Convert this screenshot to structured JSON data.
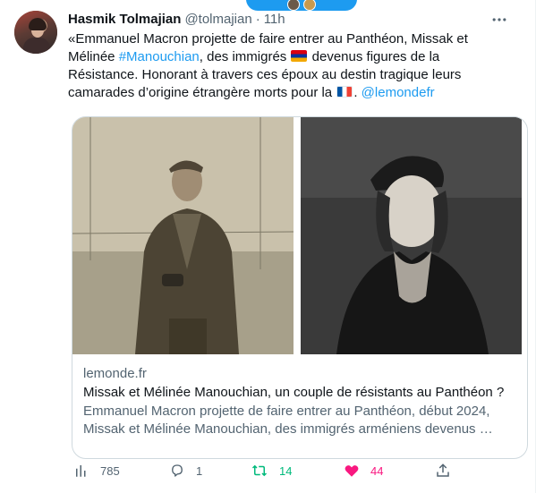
{
  "tweet": {
    "author_name": "Hasmik Tolmajian",
    "handle": "@tolmajian",
    "separator": "·",
    "time": "11h",
    "more_icon": "more-horizontal-icon",
    "text": {
      "part1": "«Emmanuel Macron projette de faire entrer au Panthéon, Missak et Mélinée ",
      "hashtag": "#Manouchian",
      "part2": ", des immigrés ",
      "part3": " devenus figures de la Résistance. Honorant à travers ces époux au destin tragique leurs camarades d’origine étrangère morts pour la ",
      "part4": ". ",
      "mention": "@lemondefr"
    },
    "flags": [
      "armenia-flag",
      "france-flag"
    ]
  },
  "card": {
    "domain": "lemonde.fr",
    "title": "Missak et Mélinée Manouchian, un couple de résistants au Panthéon ?",
    "description": "Emmanuel Macron projette de faire entrer au Panthéon, début 2024, Missak et Mélinée Manouchian, des immigrés arméniens devenus …"
  },
  "actions": {
    "views": "785",
    "replies": "1",
    "retweets": "14",
    "likes": "44"
  },
  "colors": {
    "accent": "#1d9bf0",
    "retweet": "#00ba7c",
    "like": "#f91880",
    "secondary_text": "#536471"
  }
}
